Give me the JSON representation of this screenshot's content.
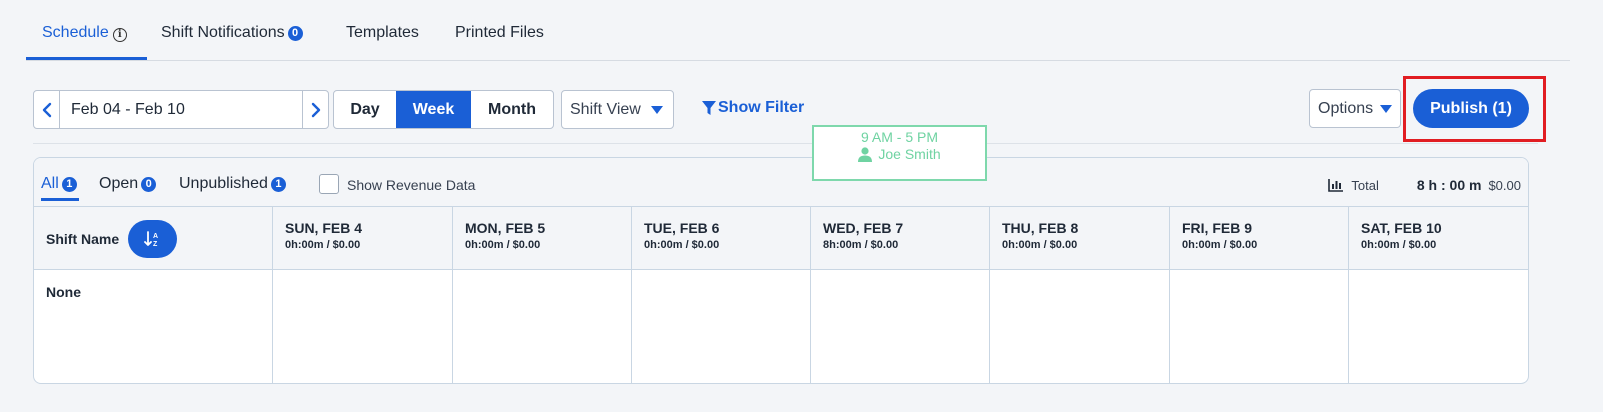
{
  "tabs": [
    {
      "label": "Schedule",
      "active": true
    },
    {
      "label": "Shift Notifications",
      "badge": "0"
    },
    {
      "label": "Templates"
    },
    {
      "label": "Printed Files"
    }
  ],
  "toolbar": {
    "date_range": "Feb 04 - Feb 10",
    "view_day": "Day",
    "view_week": "Week",
    "view_month": "Month",
    "shift_view": "Shift View",
    "show_filter": "Show Filter",
    "options": "Options",
    "publish": "Publish (1)"
  },
  "filters": {
    "all": {
      "label": "All",
      "count": "1"
    },
    "open": {
      "label": "Open",
      "count": "0"
    },
    "unpublished": {
      "label": "Unpublished",
      "count": "1"
    },
    "show_revenue": "Show Revenue Data",
    "total_label": "Total",
    "total_hours": "8 h : 00 m",
    "total_amount": "$0.00"
  },
  "grid": {
    "name_header": "Shift Name",
    "days": [
      {
        "name": "SUN, FEB 4",
        "summary": "0h:00m / $0.00"
      },
      {
        "name": "MON, FEB 5",
        "summary": "0h:00m / $0.00"
      },
      {
        "name": "TUE, FEB 6",
        "summary": "0h:00m / $0.00"
      },
      {
        "name": "WED, FEB 7",
        "summary": "8h:00m / $0.00"
      },
      {
        "name": "THU, FEB 8",
        "summary": "0h:00m / $0.00"
      },
      {
        "name": "FRI, FEB 9",
        "summary": "0h:00m / $0.00"
      },
      {
        "name": "SAT, FEB 10",
        "summary": "0h:00m / $0.00"
      }
    ],
    "rows": [
      {
        "name": "None"
      }
    ],
    "shift": {
      "time": "9 AM - 5 PM",
      "person": "Joe Smith"
    }
  },
  "colors": {
    "accent": "#1a5fd6",
    "highlight": "#e11d22",
    "shift_green": "#6fd3a2"
  },
  "icons": [
    "info-icon",
    "chevron-left-icon",
    "chevron-right-icon",
    "caret-down-icon",
    "filter-icon",
    "bar-chart-icon",
    "sort-icon",
    "person-icon"
  ]
}
